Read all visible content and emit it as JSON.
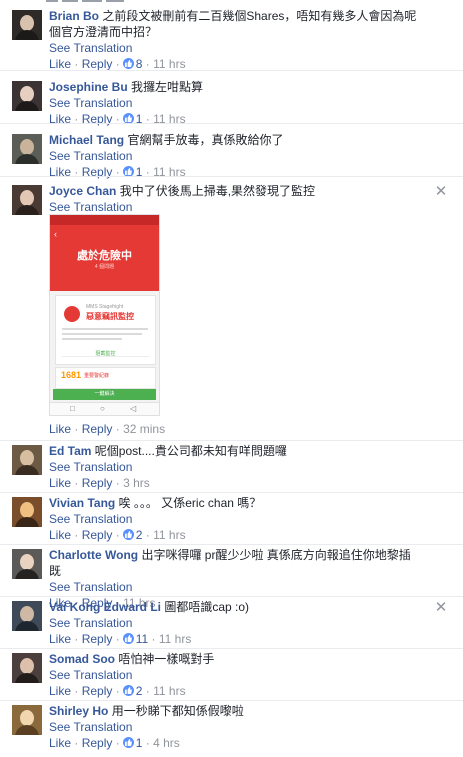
{
  "comments": [
    {
      "author": "Brian Bo",
      "text": "之前段文被刪前有二百幾個Shares，唔知有幾多人會因為呢個官方澄清而中招？",
      "see_translation": "See Translation",
      "like": "Like",
      "reply": "Reply",
      "likes": "8",
      "time": "11 hrs",
      "avatar_color": "#2e2a28"
    },
    {
      "author": "Josephine Bu",
      "text": "我攞左咁點算",
      "see_translation": "See Translation",
      "like": "Like",
      "reply": "Reply",
      "likes": "1",
      "time": "11 hrs",
      "avatar_color": "#3c3434"
    },
    {
      "author": "Michael Tang",
      "text": "官網幫手放毒，真係敗給你了",
      "see_translation": "See Translation",
      "like": "Like",
      "reply": "Reply",
      "likes": "1",
      "time": "11 hrs",
      "avatar_color": "#5a5e56"
    },
    {
      "author": "Joyce Chan",
      "text": "我中了伏後馬上掃毒,果然發現了監控",
      "see_translation": "See Translation",
      "like": "Like",
      "reply": "Reply",
      "likes": "",
      "time": "32 mins",
      "avatar_color": "#4a3a34",
      "screenshot": {
        "title": "處於危險中",
        "subtitle": "4 個問題",
        "card_label": "MMS Stagefright",
        "card_title": "惡意竊訊監控",
        "block": "阻截監控",
        "count": "1681",
        "count_label": "重要警紀錄",
        "action": "一鍵解決"
      }
    },
    {
      "author": "Ed Tam",
      "text": "呢個post....貴公司都未知有咩問題囉",
      "see_translation": "See Translation",
      "like": "Like",
      "reply": "Reply",
      "likes": "",
      "time": "3 hrs",
      "avatar_color": "#6d5a44"
    },
    {
      "author": "Vivian Tang",
      "text": "唉 。。。 又係eric chan 嗎？",
      "see_translation": "See Translation",
      "like": "Like",
      "reply": "Reply",
      "likes": "2",
      "time": "11 hrs",
      "avatar_color": "#7a4e2a"
    },
    {
      "author": "Charlotte Wong",
      "text": "出字咪得囉 pr醒少少啦 真係底方向報追住你地黎插既",
      "see_translation": "See Translation",
      "like": "Like",
      "reply": "Reply",
      "likes": "",
      "time": "11 hrs",
      "avatar_color": "#5b5a58"
    },
    {
      "author": "Vai Kong Edward Li",
      "text": "圖都唔識cap :o)",
      "see_translation": "See Translation",
      "like": "Like",
      "reply": "Reply",
      "likes": "11",
      "time": "11 hrs",
      "avatar_color": "#3e4a58"
    },
    {
      "author": "Somad Soo",
      "text": "唔怕神一樣嘅對手",
      "see_translation": "See Translation",
      "like": "Like",
      "reply": "Reply",
      "likes": "2",
      "time": "11 hrs",
      "avatar_color": "#4a3f3c"
    },
    {
      "author": "Shirley Ho",
      "text": "用一秒睇下都知係假嚟啦",
      "see_translation": "See Translation",
      "like": "Like",
      "reply": "Reply",
      "likes": "1",
      "time": "4 hrs",
      "avatar_color": "#8a6a3a"
    }
  ],
  "close_glyph": "✕",
  "dot": "·"
}
